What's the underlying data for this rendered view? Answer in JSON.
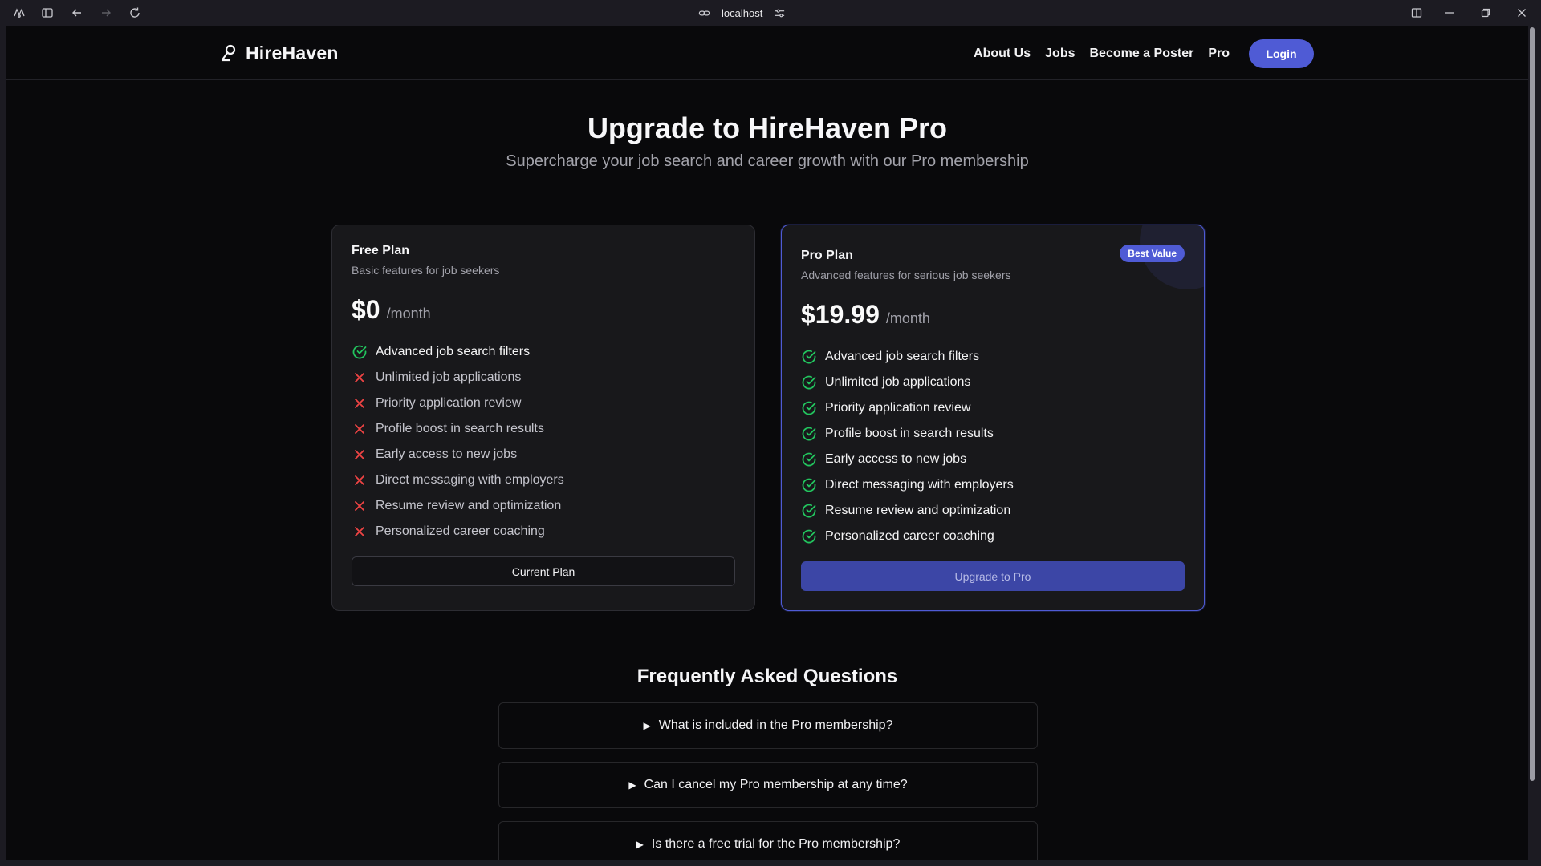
{
  "browser": {
    "url": "localhost"
  },
  "nav": {
    "brand": "HireHaven",
    "links": [
      "About Us",
      "Jobs",
      "Become a Poster",
      "Pro"
    ],
    "login": "Login"
  },
  "hero": {
    "title": "Upgrade to HireHaven Pro",
    "subtitle": "Supercharge your job search and career growth with our Pro membership"
  },
  "plans": [
    {
      "name": "Free Plan",
      "description": "Basic features for job seekers",
      "price": "$0",
      "period": "/month",
      "button": "Current Plan",
      "features": [
        {
          "text": "Advanced job search filters",
          "included": true
        },
        {
          "text": "Unlimited job applications",
          "included": false
        },
        {
          "text": "Priority application review",
          "included": false
        },
        {
          "text": "Profile boost in search results",
          "included": false
        },
        {
          "text": "Early access to new jobs",
          "included": false
        },
        {
          "text": "Direct messaging with employers",
          "included": false
        },
        {
          "text": "Resume review and optimization",
          "included": false
        },
        {
          "text": "Personalized career coaching",
          "included": false
        }
      ]
    },
    {
      "name": "Pro Plan",
      "description": "Advanced features for serious job seekers",
      "price": "$19.99",
      "period": "/month",
      "badge": "Best Value",
      "button": "Upgrade to Pro",
      "features": [
        {
          "text": "Advanced job search filters",
          "included": true
        },
        {
          "text": "Unlimited job applications",
          "included": true
        },
        {
          "text": "Priority application review",
          "included": true
        },
        {
          "text": "Profile boost in search results",
          "included": true
        },
        {
          "text": "Early access to new jobs",
          "included": true
        },
        {
          "text": "Direct messaging with employers",
          "included": true
        },
        {
          "text": "Resume review and optimization",
          "included": true
        },
        {
          "text": "Personalized career coaching",
          "included": true
        }
      ]
    }
  ],
  "faq": {
    "title": "Frequently Asked Questions",
    "items": [
      "What is included in the Pro membership?",
      "Can I cancel my Pro membership at any time?",
      "Is there a free trial for the Pro membership?"
    ]
  },
  "colors": {
    "accent": "#4f5bd5",
    "check": "#22c55e",
    "cross": "#ef4444"
  }
}
